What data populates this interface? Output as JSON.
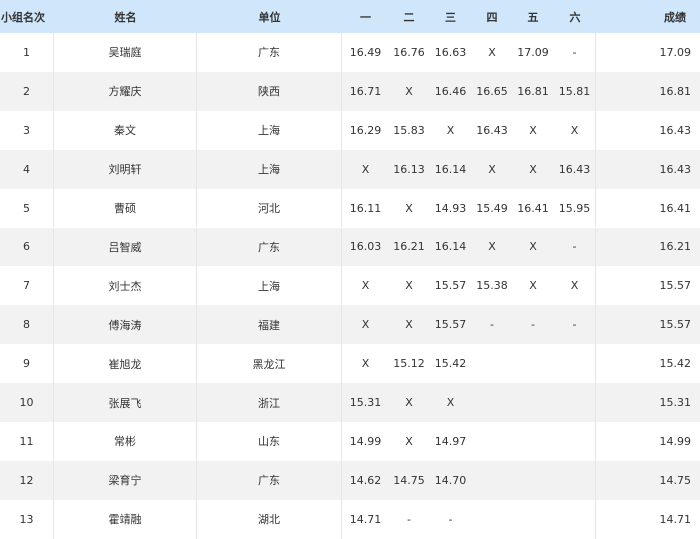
{
  "headers": [
    "小组名次",
    "姓名",
    "单位",
    "一",
    "二",
    "三",
    "四",
    "五",
    "六",
    "成绩"
  ],
  "rows": [
    [
      "1",
      "吴瑞庭",
      "广东",
      "16.49",
      "16.76",
      "16.63",
      "X",
      "17.09",
      "-",
      "17.09"
    ],
    [
      "2",
      "方耀庆",
      "陕西",
      "16.71",
      "X",
      "16.46",
      "16.65",
      "16.81",
      "15.81",
      "16.81"
    ],
    [
      "3",
      "秦文",
      "上海",
      "16.29",
      "15.83",
      "X",
      "16.43",
      "X",
      "X",
      "16.43"
    ],
    [
      "4",
      "刘明轩",
      "上海",
      "X",
      "16.13",
      "16.14",
      "X",
      "X",
      "16.43",
      "16.43"
    ],
    [
      "5",
      "曹硕",
      "河北",
      "16.11",
      "X",
      "14.93",
      "15.49",
      "16.41",
      "15.95",
      "16.41"
    ],
    [
      "6",
      "吕智威",
      "广东",
      "16.03",
      "16.21",
      "16.14",
      "X",
      "X",
      "-",
      "16.21"
    ],
    [
      "7",
      "刘士杰",
      "上海",
      "X",
      "X",
      "15.57",
      "15.38",
      "X",
      "X",
      "15.57"
    ],
    [
      "8",
      "傅海涛",
      "福建",
      "X",
      "X",
      "15.57",
      "-",
      "-",
      "-",
      "15.57"
    ],
    [
      "9",
      "崔旭龙",
      "黑龙江",
      "X",
      "15.12",
      "15.42",
      "",
      "",
      "",
      "15.42"
    ],
    [
      "10",
      "张展飞",
      "浙江",
      "15.31",
      "X",
      "X",
      "",
      "",
      "",
      "15.31"
    ],
    [
      "11",
      "常彬",
      "山东",
      "14.99",
      "X",
      "14.97",
      "",
      "",
      "",
      "14.99"
    ],
    [
      "12",
      "梁育宁",
      "广东",
      "14.62",
      "14.75",
      "14.70",
      "",
      "",
      "",
      "14.75"
    ],
    [
      "13",
      "霍靖融",
      "湖北",
      "14.71",
      "-",
      "-",
      "",
      "",
      "",
      "14.71"
    ]
  ],
  "colors": {
    "header_bg": "#cfe6fb",
    "alt_row_bg": "#f2f2f2",
    "text": "#333333"
  }
}
